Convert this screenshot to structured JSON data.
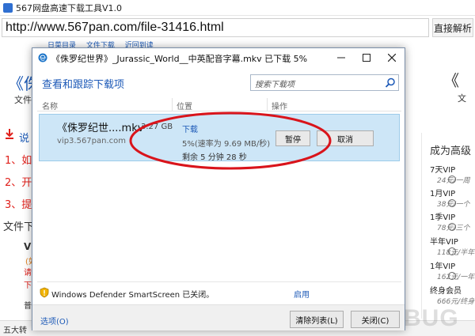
{
  "app": {
    "title": "567网盘高速下载工具V1.0",
    "url": "http://www.567pan.com/file-31416.html",
    "go_button": "直接解析"
  },
  "background": {
    "nav_strip": [
      "日菜目录",
      "文件下载",
      "近回到读"
    ],
    "big_quote": "《侏",
    "file_label": "文件",
    "desc_label": "说",
    "red_items": [
      "1、如",
      "2、开",
      "3、提"
    ],
    "file_download_label": "文件下",
    "bottom_label": "五大转",
    "right_quote": "《",
    "vip_title": "成为高级",
    "vip_rows": [
      {
        "label": "7天VIP",
        "price": "24元/一周"
      },
      {
        "label": "1月VIP",
        "price": "38元/一个"
      },
      {
        "label": "1季VIP",
        "price": "78元/三个"
      },
      {
        "label": "半年VIP",
        "price": "118元/半年"
      },
      {
        "label": "1年VIP",
        "price": "162元/一年"
      },
      {
        "label": "终身会员",
        "price": "666元/终身"
      }
    ]
  },
  "dialog": {
    "title": "《侏罗纪世界》_Jurassic_World__中英配音字幕.mkv 已下载 5%",
    "header": "查看和跟踪下载项",
    "search_placeholder": "搜索下载项",
    "columns": {
      "name": "名称",
      "location": "位置",
      "actions": "操作"
    },
    "item": {
      "filename": "《侏罗纪世....mkv",
      "host": "vip3.567pan.com",
      "size": "3.27 GB",
      "status": "下载",
      "progress": "5%(速率为 9.69 MB/秒)",
      "remaining": "剩余  5 分钟 28 秒",
      "pause_label": "暂停",
      "cancel_label": "取消",
      "percent": 5
    },
    "smartscreen": "Windows Defender SmartScreen 已关闭。",
    "enable_label": "启用",
    "options_label": "选项(O)",
    "clear_label": "清除列表(L)",
    "close_label": "关闭(C)"
  }
}
